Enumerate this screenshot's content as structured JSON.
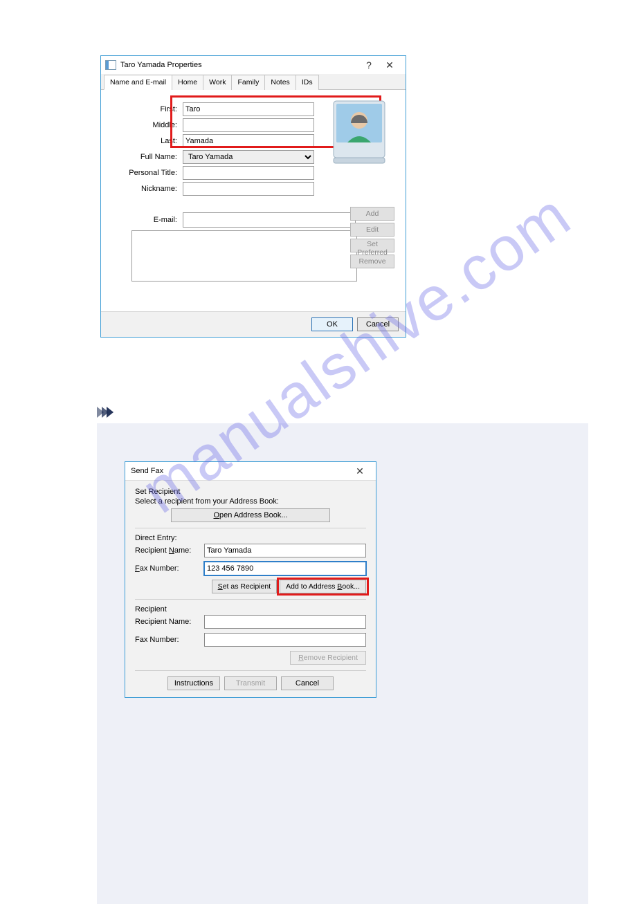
{
  "watermark": "manualshive.com",
  "dlg1": {
    "title": "Taro Yamada Properties",
    "help_symbol": "?",
    "close_symbol": "✕",
    "tabs": [
      "Name and E-mail",
      "Home",
      "Work",
      "Family",
      "Notes",
      "IDs"
    ],
    "active_tab_index": 0,
    "labels": {
      "first": "First:",
      "middle": "Middle:",
      "last": "Last:",
      "fullname": "Full Name:",
      "title": "Personal Title:",
      "nickname": "Nickname:",
      "email": "E-mail:"
    },
    "values": {
      "first": "Taro",
      "middle": "",
      "last": "Yamada",
      "fullname": "Taro Yamada",
      "title": "",
      "nickname": "",
      "email": ""
    },
    "side_buttons": [
      "Add",
      "Edit",
      "Set Preferred",
      "Remove"
    ],
    "footer": {
      "ok": "OK",
      "cancel": "Cancel"
    }
  },
  "dlg2": {
    "title": "Send Fax",
    "close_symbol": "✕",
    "set_recipient_head": "Set Recipient",
    "set_recipient_sub": "Select a recipient from your Address Book:",
    "open_ab": "Open Address Book...",
    "direct_entry_head": "Direct Entry:",
    "labels": {
      "name": "Recipient Name:",
      "fax": "Fax Number:"
    },
    "direct": {
      "name": "Taro Yamada",
      "fax": "123 456 7890"
    },
    "set_as_recipient": "Set as Recipient",
    "add_to_ab": "Add to Address Book...",
    "recipient_head": "Recipient",
    "recipient": {
      "name": "",
      "fax": ""
    },
    "remove_recipient": "Remove Recipient",
    "footer": {
      "instructions": "Instructions",
      "transmit": "Transmit",
      "cancel": "Cancel"
    }
  }
}
